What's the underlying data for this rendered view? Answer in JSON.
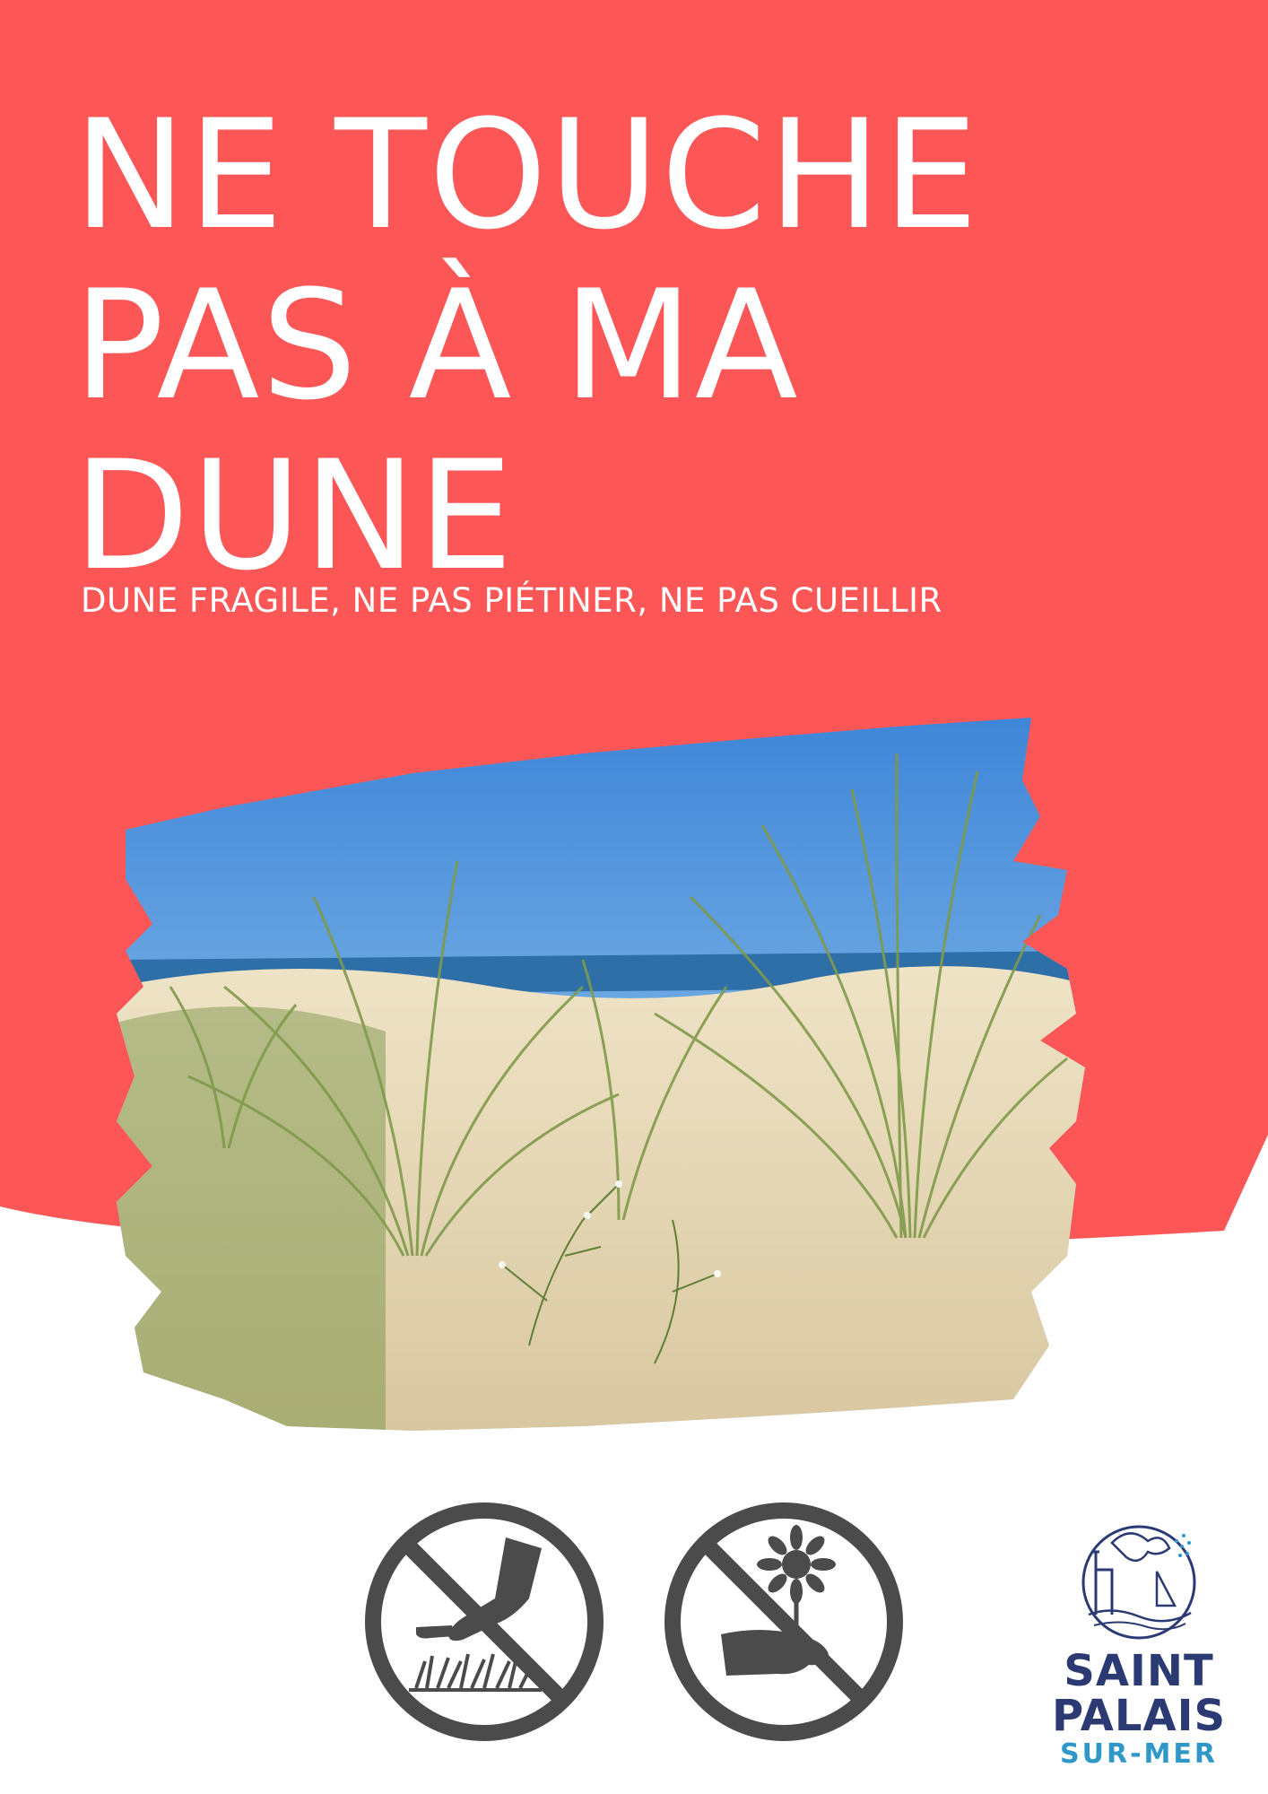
{
  "headline": {
    "lines": [
      "NE TOUCHE",
      "PAS À MA",
      "DUNE"
    ]
  },
  "subtitle": "DUNE FRAGILE, NE PAS PIÉTINER, NE PAS CUEILLIR",
  "photo": {
    "subject": "dune grasses on sand under blue sky"
  },
  "signs": [
    {
      "icon": "no-trampling-icon",
      "meaning": "ne pas piétiner"
    },
    {
      "icon": "no-picking-flowers-icon",
      "meaning": "ne pas cueillir"
    }
  ],
  "logo": {
    "line1": "SAINT",
    "line2": "PALAIS",
    "line3": "SUR-MER"
  },
  "colors": {
    "band": "#fd5657",
    "white": "#ffffff",
    "sign_grey": "#4b4b4b",
    "logo_navy": "#2b3a73",
    "logo_blue": "#2f98c9"
  }
}
